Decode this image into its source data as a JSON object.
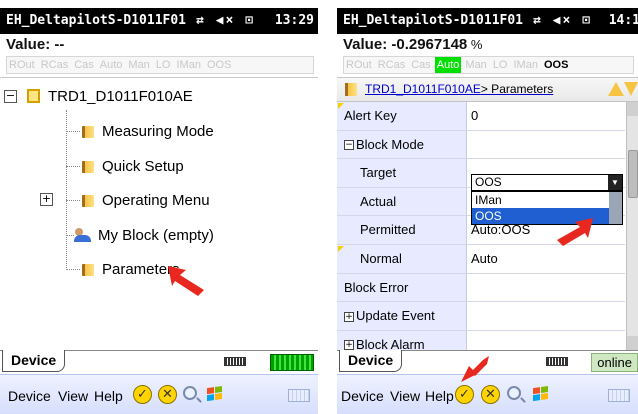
{
  "left": {
    "title": "EH_DeltapilotS-D1011F01",
    "sys_icons": "⇄ ◀× ⊡",
    "time": "13:29",
    "value_label": "Value: --",
    "value_unit": "",
    "modes": [
      "ROut",
      "RCas",
      "Cas",
      "Auto",
      "Man",
      "LO",
      "IMan",
      "OOS"
    ],
    "tree": {
      "root_expander": "−",
      "root_label": "TRD1_D1011F010AE",
      "items": [
        {
          "label": "Measuring Mode"
        },
        {
          "label": "Quick Setup"
        },
        {
          "label": "Operating Menu",
          "expander": "+"
        },
        {
          "label": "My Block (empty)"
        },
        {
          "label": "Parameters"
        }
      ]
    },
    "tab_label": "Device",
    "menu": {
      "device": "Device",
      "view": "View",
      "help": "Help"
    }
  },
  "right": {
    "title": "EH_DeltapilotS-D1011F01",
    "sys_icons": "⇄ ◀× ⊡",
    "time": "14:1",
    "value_label": "Value: -0.2967148",
    "value_unit": " %",
    "modes": [
      "ROut",
      "RCas",
      "Cas",
      "Auto",
      "Man",
      "LO",
      "IMan",
      "OOS"
    ],
    "active_mode": "Auto",
    "current_mode": "OOS",
    "breadcrumb": {
      "link": "TRD1_D1011F010AE",
      "current": "> Parameters"
    },
    "params": [
      {
        "name": "Alert Key",
        "value": "0",
        "flag": true
      },
      {
        "name": "Block Mode",
        "value": "",
        "expander": "−"
      },
      {
        "name": "Target",
        "value": "",
        "indent": true
      },
      {
        "name": "Actual",
        "value": "",
        "indent": true
      },
      {
        "name": "Permitted",
        "value": "Auto:OOS",
        "indent": true
      },
      {
        "name": "Normal",
        "value": "Auto",
        "indent": true,
        "flag": true
      },
      {
        "name": "Block Error",
        "value": ""
      },
      {
        "name": "Update Event",
        "value": "",
        "expander": "+"
      },
      {
        "name": "Block Alarm",
        "value": "",
        "expander": "+"
      }
    ],
    "dropdown": {
      "selected": "OOS",
      "options": [
        "IMan",
        "OOS"
      ],
      "highlighted": "OOS"
    },
    "tab_label": "Device",
    "status": "online",
    "menu": {
      "device": "Device",
      "view": "View",
      "help": "Help"
    }
  },
  "colors": {
    "active_mode": "#00e000",
    "highlight": "#1f5fd1",
    "arrow": "#e8281e",
    "param_name_bg": "#e8ebff"
  }
}
